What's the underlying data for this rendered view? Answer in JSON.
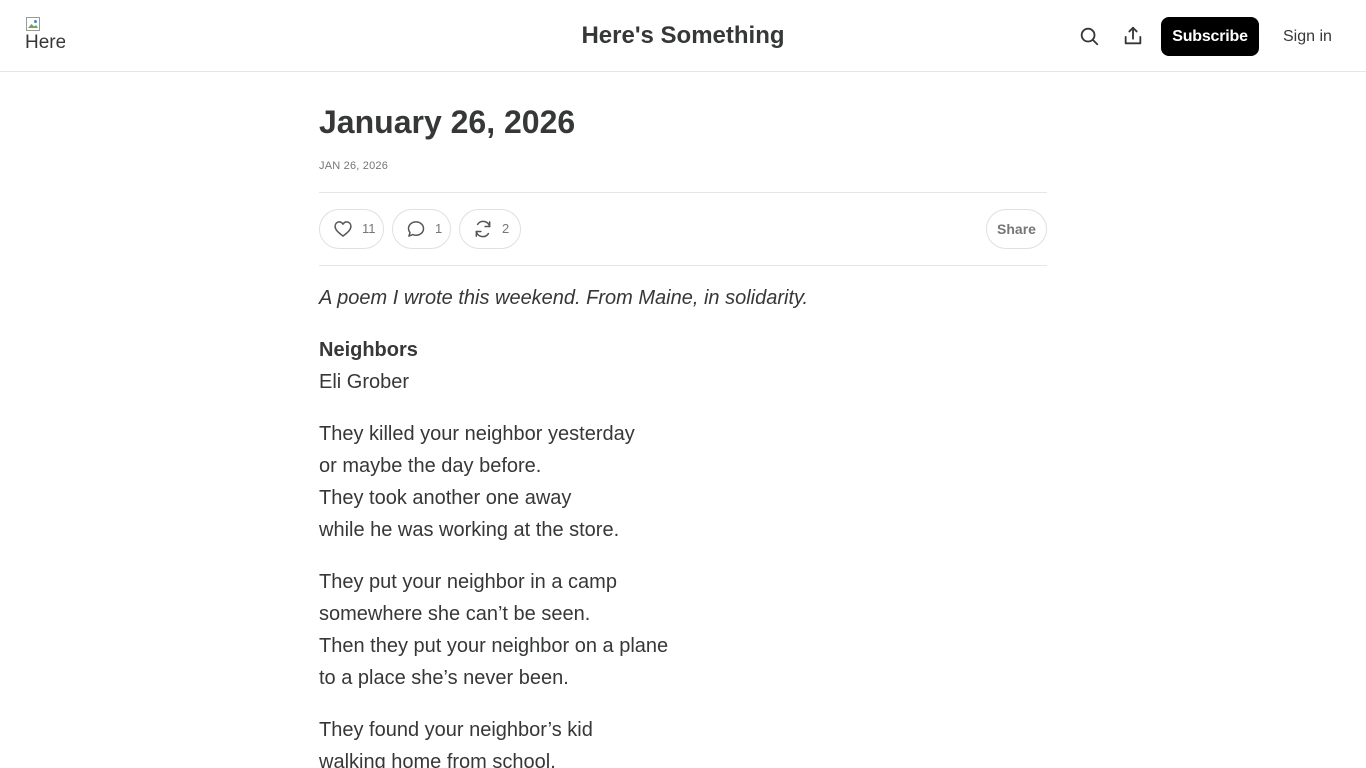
{
  "header": {
    "logo_alt": "Here's Something",
    "site_title": "Here's Something",
    "search_icon": "search-icon",
    "share_icon": "share-upload-icon",
    "subscribe_label": "Subscribe",
    "signin_label": "Sign in"
  },
  "post": {
    "title": "January 26, 2026",
    "date": "JAN 26, 2026",
    "actions": {
      "likes": "11",
      "comments": "1",
      "restacks": "2",
      "share_label": "Share"
    },
    "intro": "A poem I wrote this weekend. From Maine, in solidarity.",
    "poem_title": "Neighbors",
    "poem_author": "Eli Grober",
    "stanzas": [
      [
        "They killed your neighbor yesterday",
        "or maybe the day before.",
        "They took another one away",
        "while he was working at the store."
      ],
      [
        "They put your neighbor in a camp",
        "somewhere she can’t be seen.",
        "Then they put your neighbor on a plane",
        "to a place she’s never been."
      ],
      [
        "They found your neighbor’s kid",
        "walking home from school."
      ]
    ]
  },
  "colors": {
    "text": "#363737",
    "muted": "#767676",
    "border": "#e6e6e6",
    "subscribe_bg": "#000000"
  }
}
